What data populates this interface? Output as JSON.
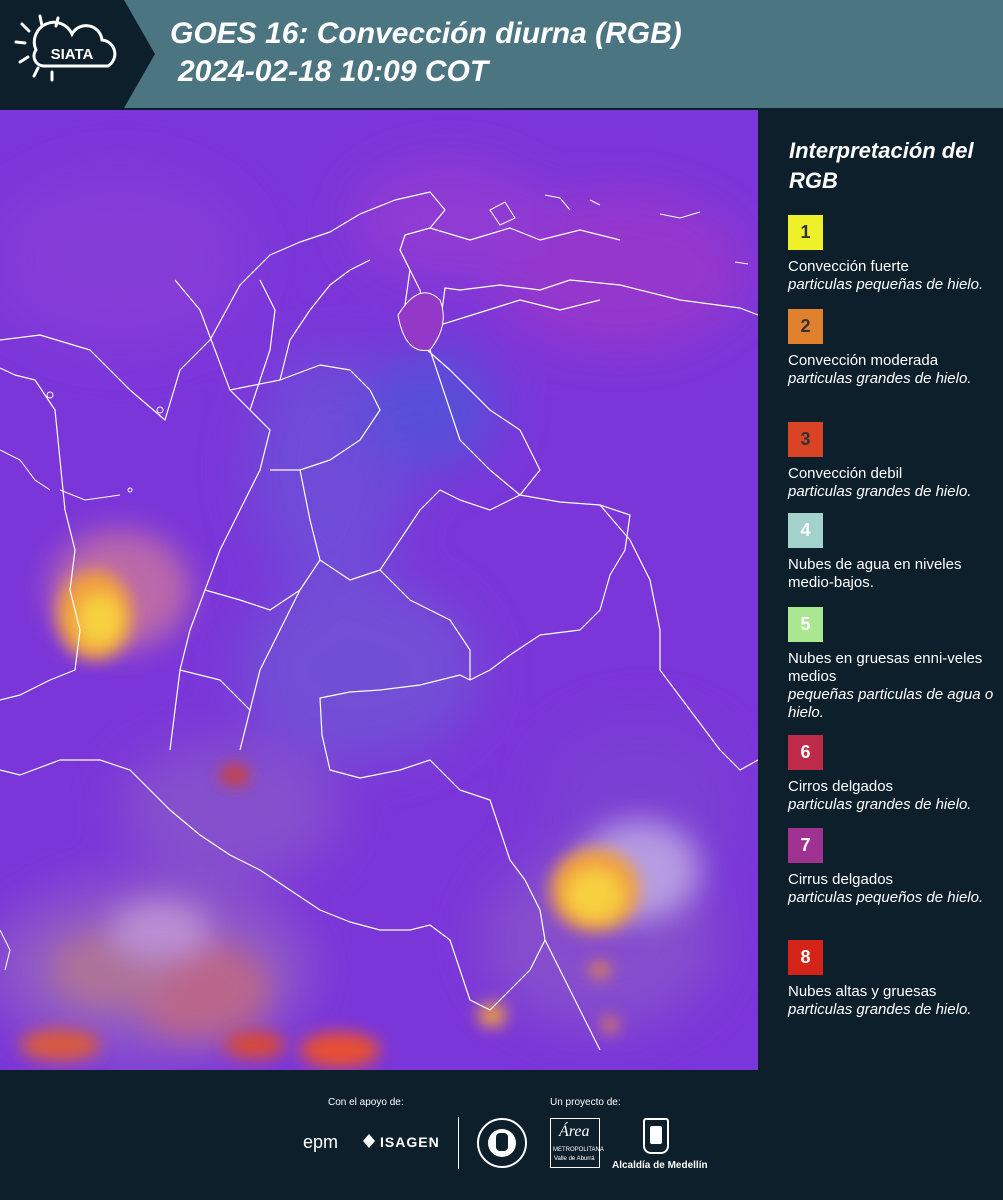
{
  "header": {
    "logo_text": "SIATA",
    "title_line1": "GOES 16: Convección diurna (RGB)",
    "title_line2": "2024-02-18 10:09 COT"
  },
  "legend": {
    "title": "Interpretación del RGB",
    "items": [
      {
        "number": "1",
        "color": "#eef02a",
        "text_color": "#333333",
        "label": "Convección fuerte",
        "desc": "particulas pequeñas de hielo."
      },
      {
        "number": "2",
        "color": "#e2812d",
        "text_color": "#333333",
        "label": "Convección moderada",
        "desc": "particulas grandes de hielo."
      },
      {
        "number": "3",
        "color": "#d94425",
        "text_color": "#333333",
        "label": "Convección debil",
        "desc": "particulas grandes de hielo."
      },
      {
        "number": "4",
        "color": "#a3d1cb",
        "text_color": "#ffffff",
        "label": "Nubes de agua en niveles medio-bajos.",
        "desc": ""
      },
      {
        "number": "5",
        "color": "#a9e890",
        "text_color": "#ffffff",
        "label": "Nubes en gruesas enni-veles medios",
        "desc": "pequeñas particulas de agua o hielo."
      },
      {
        "number": "6",
        "color": "#be2b4a",
        "text_color": "#ffffff",
        "label": "Cirros delgados",
        "desc": "particulas grandes de hielo."
      },
      {
        "number": "7",
        "color": "#a03292",
        "text_color": "#ffffff",
        "label": "Cirrus delgados",
        "desc": "particulas pequeños de hielo."
      },
      {
        "number": "8",
        "color": "#d42318",
        "text_color": "#ffffff",
        "label": "Nubes altas y gruesas",
        "desc": "particulas grandes de hielo."
      }
    ]
  },
  "footer": {
    "support_caption": "Con el apoyo de:",
    "project_caption": "Un proyecto de:",
    "sponsor1": "epm",
    "sponsor2": "ISAGEN",
    "partner_area": "Área",
    "partner_area_sub": "METROPOLITANA",
    "partner_area_sub2": "Valle de Aburrá",
    "partner_alcaldia": "Alcaldía de Medellín"
  },
  "colors": {
    "background": "#0d1f2b",
    "header": "#4c7582",
    "map_base": "#7b36d9",
    "border_lines": "#ffffff"
  }
}
